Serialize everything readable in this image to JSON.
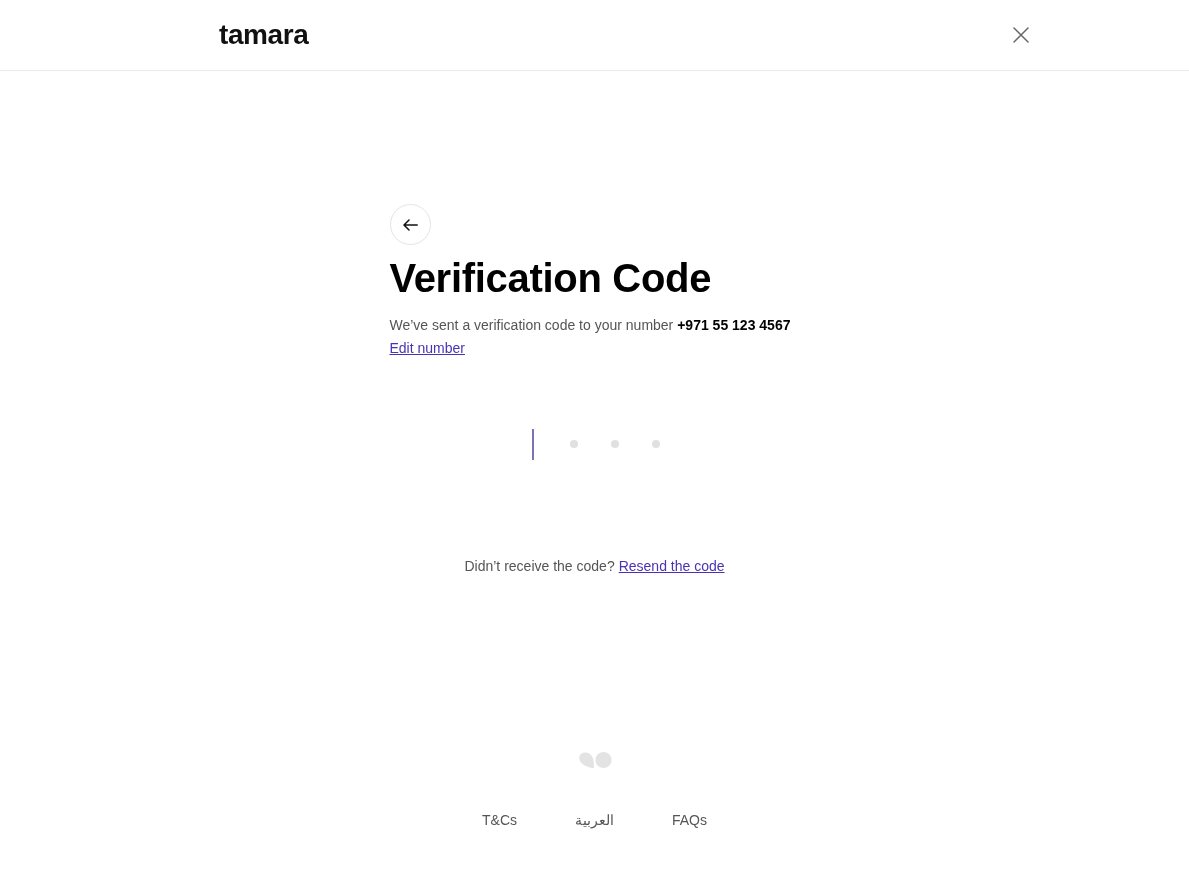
{
  "header": {
    "logo": "tamara"
  },
  "title": "Verification Code",
  "message": "We’ve sent a verification code to your number **+971 55 123 4567**",
  "edit_link": "Edit number",
  "code_slots": [
    {
      "focused": true
    },
    {
      "focused": false
    },
    {
      "focused": false
    },
    {
      "focused": false
    }
  ],
  "resend": {
    "prompt": "Didn’t receive the code?",
    "link": "Resend the code"
  },
  "footer_links": [
    {
      "label": "T&Cs"
    },
    {
      "label": "العربية"
    },
    {
      "label": "FAQs"
    }
  ]
}
